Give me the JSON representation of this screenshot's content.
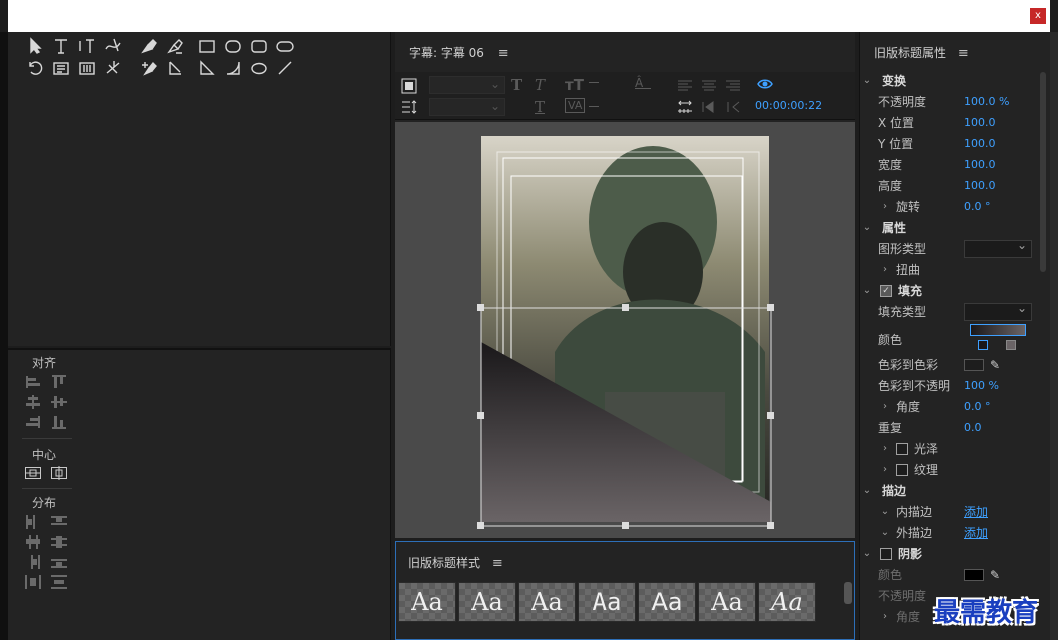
{
  "window": {
    "close_label": "x"
  },
  "align_panel": {
    "align_label": "对齐",
    "center_label": "中心",
    "distribute_label": "分布"
  },
  "editor": {
    "title": "字幕: 字幕 06",
    "menu_glyph": "≡",
    "timecode": "00:00:00:22"
  },
  "styles": {
    "title": "旧版标题样式",
    "menu_glyph": "≡",
    "tiles": [
      "Aa",
      "Aa",
      "Aa",
      "Aa",
      "Aa",
      "Aa",
      "Aa"
    ]
  },
  "props": {
    "title": "旧版标题属性",
    "menu_glyph": "≡",
    "transform": {
      "header": "变换",
      "opacity_label": "不透明度",
      "opacity_value": "100.0 %",
      "x_label": "X 位置",
      "x_value": "100.0",
      "y_label": "Y 位置",
      "y_value": "100.0",
      "width_label": "宽度",
      "width_value": "100.0",
      "height_label": "高度",
      "height_value": "100.0",
      "rotation_label": "旋转",
      "rotation_value": "0.0 °"
    },
    "attributes": {
      "header": "属性",
      "graphic_type_label": "图形类型",
      "distort_label": "扭曲"
    },
    "fill": {
      "header": "填充",
      "fill_type_label": "填充类型",
      "color_label": "颜色",
      "color_to_color_label": "色彩到色彩",
      "color_to_opacity_label": "色彩到不透明",
      "color_to_opacity_value": "100 %",
      "angle_label": "角度",
      "angle_value": "0.0 °",
      "repeat_label": "重复",
      "repeat_value": "0.0",
      "sheen_label": "光泽",
      "texture_label": "纹理"
    },
    "stroke": {
      "header": "描边",
      "inner_label": "内描边",
      "inner_add": "添加",
      "outer_label": "外描边",
      "outer_add": "添加"
    },
    "shadow": {
      "header": "阴影",
      "color_label": "颜色",
      "opacity_label": "不透明度",
      "angle_label": "角度"
    }
  },
  "watermark": "最需教育",
  "colors": {
    "accent": "#3ea0ff",
    "panel": "#232323",
    "close": "#c62828"
  }
}
